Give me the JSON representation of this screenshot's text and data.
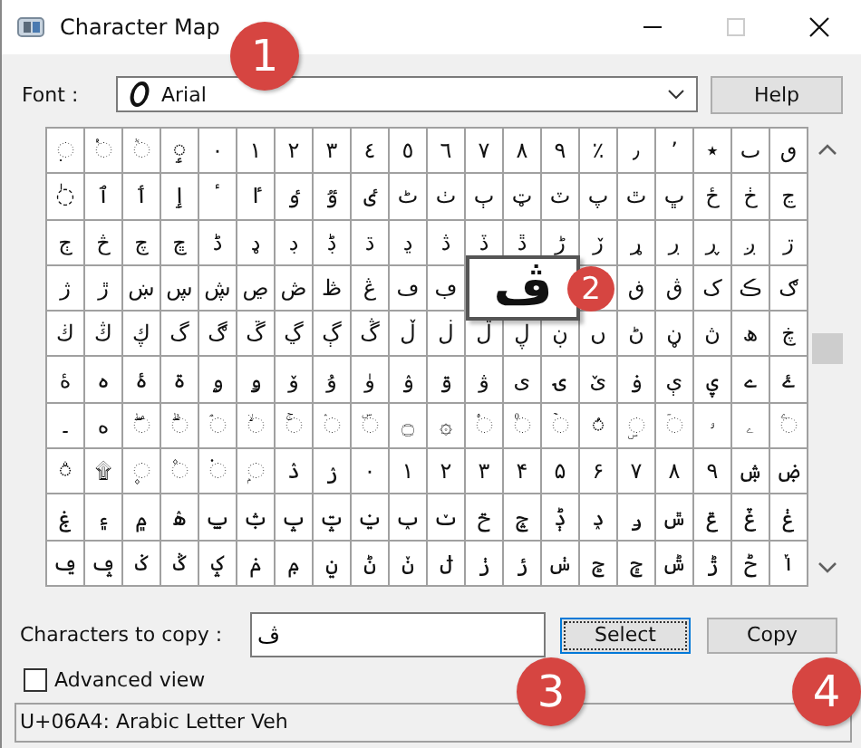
{
  "window": {
    "title": "Character Map"
  },
  "font": {
    "label": "Font :",
    "value": "Arial"
  },
  "help_button": "Help",
  "grid": {
    "rows": [
      [
        "◌ٜ",
        "◌ٝ",
        "◌ٞ",
        "◌ٟ",
        "٠",
        "١",
        "٢",
        "٣",
        "٤",
        "٥",
        "٦",
        "٧",
        "٨",
        "٩",
        "٪",
        "٫",
        "٬",
        "٭",
        "ٮ",
        "ٯ"
      ],
      [
        "◌ٰ",
        "ٱ",
        "ٲ",
        "ٳ",
        "ٴ",
        "ٵ",
        "ٶ",
        "ٷ",
        "ٸ",
        "ٹ",
        "ٺ",
        "ٻ",
        "ټ",
        "ٽ",
        "پ",
        "ٿ",
        "ڀ",
        "ځ",
        "ڂ",
        "ڃ"
      ],
      [
        "ڄ",
        "څ",
        "چ",
        "ڇ",
        "ڈ",
        "ډ",
        "ڊ",
        "ڋ",
        "ڌ",
        "ڍ",
        "ڎ",
        "ڏ",
        "ڐ",
        "ڑ",
        "ڒ",
        "ړ",
        "ڔ",
        "ڕ",
        "ږ",
        "ڗ"
      ],
      [
        "ژ",
        "ڙ",
        "ښ",
        "ڛ",
        "ڜ",
        "ڝ",
        "ڞ",
        "ڟ",
        "ڠ",
        "ڡ",
        "ڢ",
        null,
        null,
        null,
        null,
        "ڧ",
        "ڨ",
        "ک",
        "ڪ",
        "ګ"
      ],
      [
        "ڬ",
        "ڭ",
        "ڮ",
        "گ",
        "ڰ",
        "ڱ",
        "ڲ",
        "ڳ",
        "ڴ",
        "ڵ",
        "ڶ",
        "ڷ",
        "ڸ",
        "ڹ",
        "ں",
        "ڻ",
        "ڼ",
        "ڽ",
        "ھ",
        "ڿ"
      ],
      [
        "ۀ",
        "ہ",
        "ۂ",
        "ۃ",
        "ۄ",
        "ۅ",
        "ۆ",
        "ۇ",
        "ۈ",
        "ۉ",
        "ۊ",
        "ۋ",
        "ی",
        "ۍ",
        "ێ",
        "ۏ",
        "ې",
        "ۑ",
        "ے",
        "ۓ"
      ],
      [
        "۔",
        "ە",
        "◌ۖ",
        "◌ۗ",
        "◌ۘ",
        "◌ۙ",
        "◌ۚ",
        "◌ۛ",
        "◌ۜ",
        "۝",
        "۞",
        "◌۟",
        "◌۠",
        "◌ۡ",
        "◌ۢ",
        "◌ۣ",
        "◌ۤ",
        "ۥ",
        "ۦ",
        "◌ۧ"
      ],
      [
        "◌ۨ",
        "۩",
        "◌۪",
        "◌۫",
        "◌۬",
        "◌ۭ",
        "ۮ",
        "ۯ",
        "۰",
        "۱",
        "۲",
        "۳",
        "۴",
        "۵",
        "۶",
        "۷",
        "۸",
        "۹",
        "ۺ",
        "ۻ"
      ],
      [
        "ۼ",
        "۽",
        "۾",
        "ۿ",
        "ݐ",
        "ݑ",
        "ݒ",
        "ݓ",
        "ݔ",
        "ݕ",
        "ݖ",
        "ݗ",
        "ݘ",
        "ݙ",
        "ݚ",
        "ݛ",
        "ݜ",
        "ݝ",
        "ݞ",
        "ݟ"
      ],
      [
        "ݠ",
        "ݡ",
        "ݢ",
        "ݣ",
        "ݤ",
        "ݥ",
        "ݦ",
        "ݧ",
        "ݨ",
        "ݩ",
        "ݪ",
        "ݫ",
        "ݬ",
        "ݭ",
        "ݮ",
        "ݯ",
        "ݰ",
        "ݱ",
        "ݲ",
        "ݳ"
      ]
    ],
    "magnified": "ڤ"
  },
  "copy": {
    "label": "Characters to copy :",
    "value": "ڤ"
  },
  "buttons": [
    {
      "label": "Select",
      "focused": true
    },
    {
      "label": "Copy",
      "focused": false
    }
  ],
  "advanced_view": {
    "label": "Advanced view",
    "checked": false
  },
  "status_bar": "U+06A4: Arabic Letter Veh",
  "annotations": [
    "1",
    "2",
    "3",
    "4"
  ]
}
